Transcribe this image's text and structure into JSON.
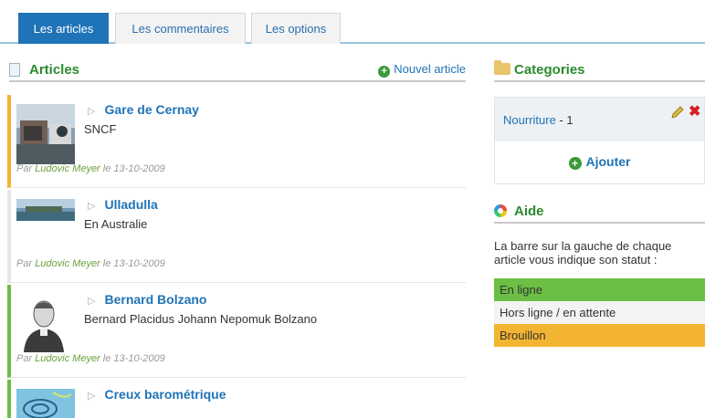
{
  "tabs": [
    {
      "label": "Les articles",
      "active": true
    },
    {
      "label": "Les commentaires",
      "active": false
    },
    {
      "label": "Les options",
      "active": false
    }
  ],
  "articles_section": {
    "title": "Articles",
    "new_article_label": "Nouvel article",
    "items": [
      {
        "title": "Gare de Cernay",
        "subtitle": "SNCF",
        "by": "Par",
        "author": "Ludovic Meyer",
        "on": "le",
        "date": "13-10-2009",
        "status": "brouillon"
      },
      {
        "title": "Ulladulla",
        "subtitle": "En Australie",
        "by": "Par",
        "author": "Ludovic Meyer",
        "on": "le",
        "date": "13-10-2009",
        "status": "hors"
      },
      {
        "title": "Bernard Bolzano",
        "subtitle": "Bernard Placidus Johann Nepomuk Bolzano",
        "by": "Par",
        "author": "Ludovic Meyer",
        "on": "le",
        "date": "13-10-2009",
        "status": "ligne"
      },
      {
        "title": "Creux barométrique",
        "subtitle": "",
        "status": "ligne"
      }
    ]
  },
  "categories": {
    "title": "Categories",
    "items": [
      {
        "name": "Nourriture",
        "separator": "-",
        "count": "1"
      }
    ],
    "add_label": "Ajouter"
  },
  "help": {
    "title": "Aide",
    "text": "La barre sur la gauche de chaque article vous indique son statut :",
    "legend": [
      {
        "label": "En ligne",
        "color": "#6cbe45"
      },
      {
        "label": "Hors ligne / en attente",
        "color": "#f3f3f3"
      },
      {
        "label": "Brouillon",
        "color": "#f3b531"
      }
    ]
  },
  "colors": {
    "accent": "#1f73b7",
    "heading_green": "#2c8a2c"
  }
}
